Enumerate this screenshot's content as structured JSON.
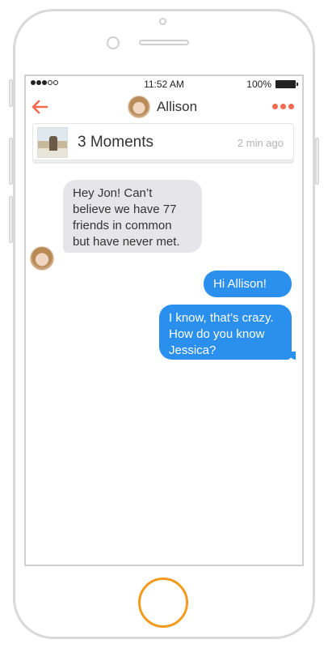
{
  "status_bar": {
    "time": "11:52 AM",
    "battery": "100%"
  },
  "navbar": {
    "contact_name": "Allison",
    "accent_color": "#f26b4e"
  },
  "moments": {
    "title": "3 Moments",
    "time": "2 min ago"
  },
  "messages": [
    {
      "direction": "incoming",
      "text": "Hey Jon! Can’t\nbelieve we have 77\nfriends in common\nbut have never met."
    },
    {
      "direction": "outgoing",
      "text": "Hi Allison!"
    },
    {
      "direction": "outgoing",
      "text": "I know, that’s crazy.\nHow do you know\nJessica?"
    }
  ],
  "colors": {
    "outgoing_bubble": "#2b8fee",
    "incoming_bubble": "#e6e6ea",
    "home_button": "#f39a1e"
  }
}
